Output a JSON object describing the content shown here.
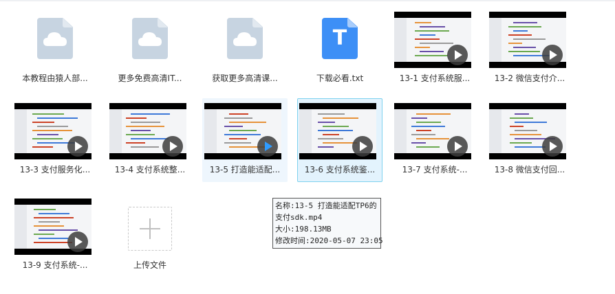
{
  "files": [
    {
      "name": "本教程由猿人部...",
      "type": "cloud-doc",
      "state": "normal"
    },
    {
      "name": "更多免费高清IT...",
      "type": "cloud-doc",
      "state": "normal"
    },
    {
      "name": "获取更多高清课...",
      "type": "cloud-doc",
      "state": "normal"
    },
    {
      "name": "下载必看.txt",
      "type": "txt",
      "glyph": "T",
      "state": "normal"
    },
    {
      "name": "13-1 支付系统服...",
      "type": "video",
      "state": "normal"
    },
    {
      "name": "13-2 微信支付介...",
      "type": "video",
      "state": "normal"
    },
    {
      "name": "13-3 支付服务化...",
      "type": "video",
      "state": "normal"
    },
    {
      "name": "13-4 支付系统整...",
      "type": "video",
      "state": "normal"
    },
    {
      "name": "13-5 打造能适配...",
      "type": "video",
      "state": "hover"
    },
    {
      "name": "13-6 支付系统鉴...",
      "type": "video",
      "state": "selected"
    },
    {
      "name": "13-7 支付系统-...",
      "type": "video",
      "state": "normal"
    },
    {
      "name": "13-8 微信支付回...",
      "type": "video",
      "state": "normal"
    },
    {
      "name": "13-9 支付系统-...",
      "type": "video",
      "state": "normal"
    }
  ],
  "upload": {
    "label": "上传文件"
  },
  "tooltip": {
    "name_line1": "名称:13-5 打造能适配TP6的",
    "name_line2": "支付sdk.mp4",
    "size": "大小:198.13MB",
    "modified": "修改时间:2020-05-07 23:05"
  },
  "colors": {
    "selected_border": "#7dd1ee",
    "selected_bg": "#e3f3fd",
    "play_active": "#2f9bff",
    "txt_icon": "#3d8ff6"
  }
}
